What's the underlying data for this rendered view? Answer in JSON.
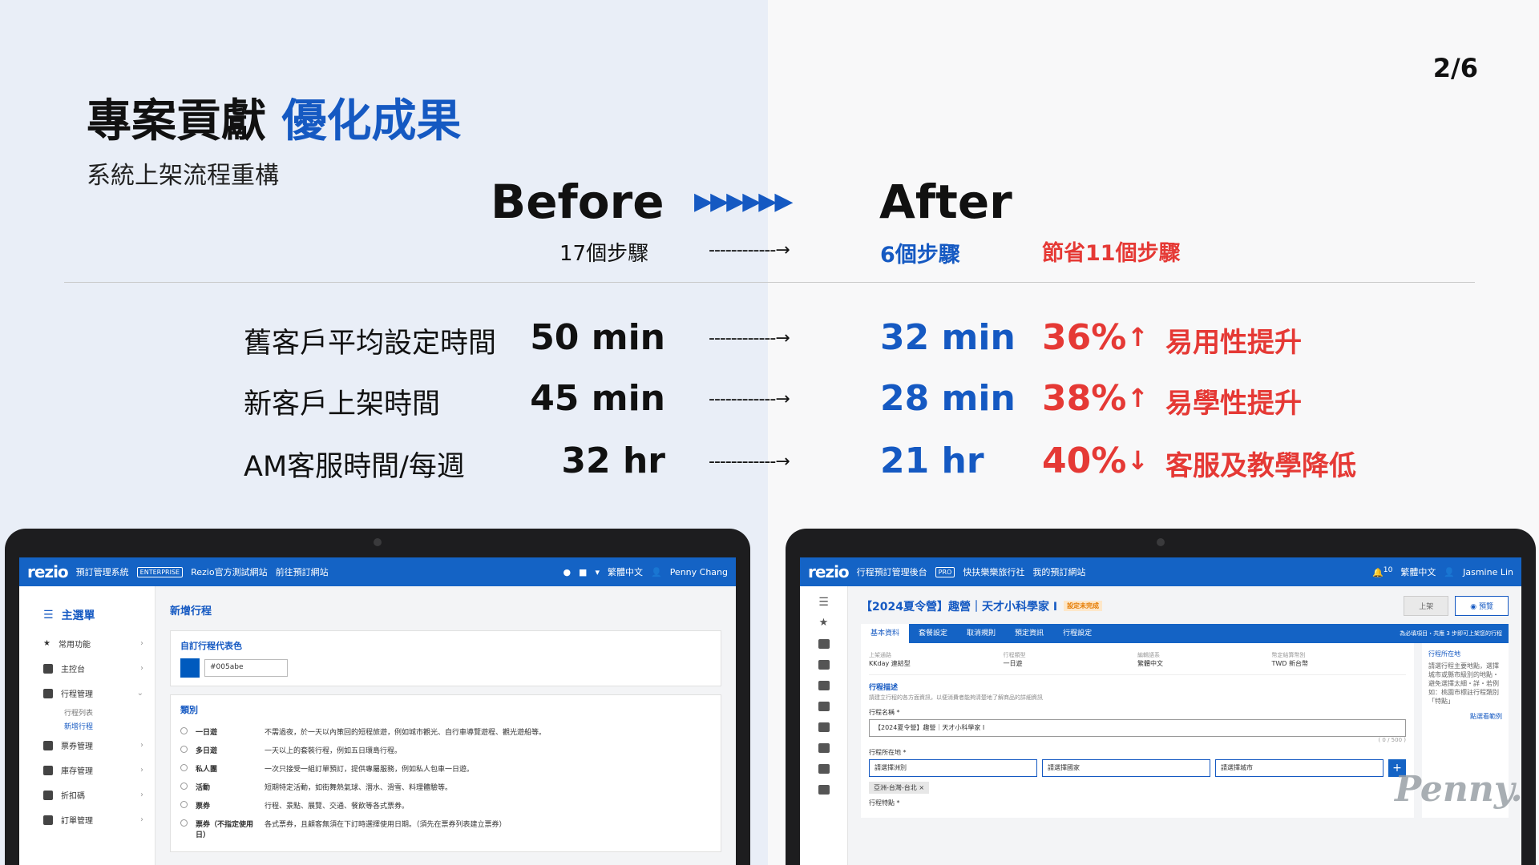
{
  "page": {
    "number": "2/6"
  },
  "title": {
    "main": "專案貢獻",
    "highlight": "優化成果"
  },
  "subtitle": "系統上架流程重構",
  "comparison": {
    "before_label": "Before",
    "after_label": "After",
    "chevrons": "▶▶▶▶▶▶",
    "steps_before": "17個步驟",
    "steps_after": "6個步驟",
    "steps_saved": "節省11個步驟",
    "arrow": "------------→"
  },
  "metrics": [
    {
      "label": "舊客戶平均設定時間",
      "before": "50 min",
      "after": "32 min",
      "percent": "36%",
      "direction": "↑",
      "improvement": "易用性提升"
    },
    {
      "label": "新客戶上架時間",
      "before": "45 min",
      "after": "28 min",
      "percent": "38%",
      "direction": "↑",
      "improvement": "易學性提升"
    },
    {
      "label": "AM客服時間/每週",
      "before": "32 hr",
      "after": "21 hr",
      "percent": "40%",
      "direction": "↓",
      "improvement": "客服及教學降低"
    }
  ],
  "before_screen": {
    "logo": "rezio",
    "system_name": "預訂管理系統",
    "edition": "ENTERPRISE",
    "site_name": "Rezio官方測試網站",
    "link": "前往預訂網站",
    "language": "繁體中文",
    "user": "Penny Chang",
    "menu_title": "主選單",
    "menu_items": [
      {
        "label": "常用功能",
        "icon": "star-icon"
      },
      {
        "label": "主控台",
        "icon": "dashboard-icon"
      },
      {
        "label": "行程管理",
        "icon": "folder-icon"
      },
      {
        "label": "票券管理",
        "icon": "ticket-icon"
      },
      {
        "label": "庫存管理",
        "icon": "inventory-icon"
      },
      {
        "label": "折扣碼",
        "icon": "tag-icon"
      },
      {
        "label": "訂單管理",
        "icon": "document-icon"
      }
    ],
    "submenu": [
      "行程列表",
      "新增行程"
    ],
    "page_title": "新增行程",
    "color_section": "自訂行程代表色",
    "color_value": "#005abe",
    "category_section": "類別",
    "categories": [
      {
        "name": "一日遊",
        "desc": "不需過夜，於一天以內策回的短程旅遊，例如城市觀光、自行車導覽遊程、觀光遊船等。"
      },
      {
        "name": "多日遊",
        "desc": "一天以上的套裝行程，例如五日環島行程。"
      },
      {
        "name": "私人團",
        "desc": "一次只接受一組訂單預訂，提供專屬服務，例如私人包車一日遊。"
      },
      {
        "name": "活動",
        "desc": "短期特定活動，如街舞熱氣球、潛水、滑雪、料理體驗等。"
      },
      {
        "name": "票券",
        "desc": "行程、景點、展覽、交通、餐飲等各式票券。"
      },
      {
        "name": "票券（不指定使用日）",
        "desc": "各式票券，且顧客無須在下訂時選擇使用日期。（須先在票券列表建立票券）"
      }
    ]
  },
  "after_screen": {
    "logo": "rezio",
    "system_name": "行程預訂管理後台",
    "plan": "PRO",
    "company": "快扶樂樂旅行社",
    "link": "我的預訂網站",
    "notif_count": "10",
    "language": "繁體中文",
    "user": "Jasmine Lin",
    "product_title": "【2024夏令營】趣營｜天才小科學家 I",
    "status": "設定未完成",
    "btn_publish": "上架",
    "btn_preview": "預覽",
    "tabs": [
      "基本資料",
      "套餐設定",
      "取消規則",
      "預定資訊",
      "行程設定"
    ],
    "tab_hint": "為必填項目・共應 3 步即可上架您的行程",
    "info": [
      {
        "k": "上架通路",
        "v": "KKday 連結型"
      },
      {
        "k": "行程類型",
        "v": "一日遊"
      },
      {
        "k": "編輯語系",
        "v": "繁體中文"
      },
      {
        "k": "幣定結算幣別",
        "v": "TWD 新台幣"
      }
    ],
    "desc_section": "行程描述",
    "desc_hint": "請建立行程的各方面資訊，以便消費者能夠清楚地了解商品的詳細資訊",
    "name_label": "行程名稱 *",
    "name_value": "【2024夏令營】趣營｜天才小科學家 I",
    "char_count": "( 0 / 500 )",
    "location_label": "行程所在地 *",
    "location_ph_1": "請選擇洲別",
    "location_ph_2": "請選擇國家",
    "location_ph_3": "請選擇城市",
    "location_chip": "亞洲-台灣-台北 ×",
    "theme_label": "行程特點 *",
    "side_title": "行程所在地",
    "side_text": "請選行程主要地點，選擇城市或縣市級別的地點・避免選擇太細・詳・若例如：桃園市標註行程類別「特點」",
    "side_link": "點選看範例"
  },
  "watermark": "Penny."
}
